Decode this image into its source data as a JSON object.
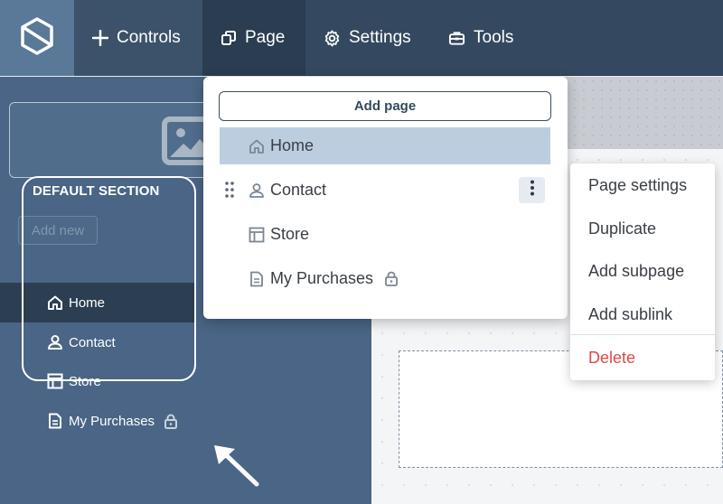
{
  "topbar": {
    "logo_icon": "hexagon-logo-icon",
    "nav": [
      {
        "label": "Controls",
        "icon": "plus-icon"
      },
      {
        "label": "Page",
        "icon": "pages-icon"
      },
      {
        "label": "Settings",
        "icon": "gear-icon"
      },
      {
        "label": "Tools",
        "icon": "toolbox-icon"
      }
    ]
  },
  "sidebar": {
    "image_icon": "image-placeholder-icon",
    "add_new_label": "Add new",
    "section_title": "DEFAULT SECTION",
    "items": [
      {
        "label": "Home",
        "icon": "home-icon",
        "active": true
      },
      {
        "label": "Contact",
        "icon": "user-icon"
      },
      {
        "label": "Store",
        "icon": "store-layout-icon"
      },
      {
        "label": "My Purchases",
        "icon": "document-icon",
        "locked": true
      }
    ]
  },
  "page_menu": {
    "add_page_label": "Add page",
    "pages": [
      {
        "label": "Home",
        "icon": "home-icon",
        "selected": true
      },
      {
        "label": "Contact",
        "icon": "user-icon"
      },
      {
        "label": "Store",
        "icon": "store-layout-icon"
      },
      {
        "label": "My Purchases",
        "icon": "document-icon",
        "locked": true
      }
    ]
  },
  "context_menu": {
    "items": [
      "Page settings",
      "Duplicate",
      "Add subpage",
      "Add sublink"
    ],
    "delete_label": "Delete"
  },
  "colors": {
    "topbar": "#34495f",
    "sidebar": "#4a6585",
    "selected_row": "#bccde0",
    "danger": "#e0484a"
  }
}
